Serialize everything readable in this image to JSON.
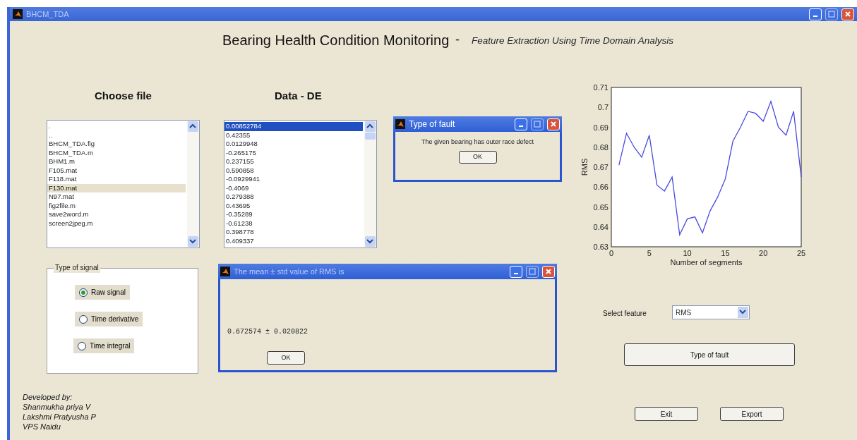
{
  "window": {
    "title": "BHCM_TDA"
  },
  "heading": {
    "title": "Bearing Health Condition Monitoring",
    "separator": "-",
    "subtitle": "Feature Extraction Using Time Domain Analysis"
  },
  "file_list": {
    "label": "Choose file",
    "focused": false,
    "items": [
      {
        "text": ".",
        "selected": false
      },
      {
        "text": "..",
        "selected": false
      },
      {
        "text": "BHCM_TDA.fig",
        "selected": false
      },
      {
        "text": "BHCM_TDA.m",
        "selected": false
      },
      {
        "text": "BHM1.m",
        "selected": false
      },
      {
        "text": "F105.mat",
        "selected": false
      },
      {
        "text": "F118.mat",
        "selected": false
      },
      {
        "text": "F130.mat",
        "selected": true
      },
      {
        "text": "N97.mat",
        "selected": false
      },
      {
        "text": "fig2file.m",
        "selected": false
      },
      {
        "text": "save2word.m",
        "selected": false
      },
      {
        "text": "screen2jpeg.m",
        "selected": false
      }
    ]
  },
  "data_list": {
    "label": "Data - DE",
    "focused": true,
    "items": [
      {
        "text": "0.00852784",
        "selected": true
      },
      {
        "text": "0.42355",
        "selected": false
      },
      {
        "text": "0.0129948",
        "selected": false
      },
      {
        "text": "-0.265175",
        "selected": false
      },
      {
        "text": "0.237155",
        "selected": false
      },
      {
        "text": "0.590858",
        "selected": false
      },
      {
        "text": "-0.0929941",
        "selected": false
      },
      {
        "text": "-0.4069",
        "selected": false
      },
      {
        "text": "0.279388",
        "selected": false
      },
      {
        "text": "0.43695",
        "selected": false
      },
      {
        "text": "-0.35289",
        "selected": false
      },
      {
        "text": "-0.61238",
        "selected": false
      },
      {
        "text": "0.398778",
        "selected": false
      },
      {
        "text": "0.409337",
        "selected": false
      }
    ]
  },
  "signal_panel": {
    "title": "Type of signal",
    "options": [
      {
        "label": "Raw signal",
        "selected": true
      },
      {
        "label": "Time derivative",
        "selected": false
      },
      {
        "label": "Time integral",
        "selected": false
      }
    ]
  },
  "credits": [
    "Developed by:",
    "Shanmukha priya V",
    "Lakshmi Pratyusha P",
    "VPS Naidu"
  ],
  "chart": {
    "chart_data": {
      "type": "line",
      "xlabel": "Number of segments",
      "ylabel": "RMS",
      "x": [
        1,
        2,
        3,
        4,
        5,
        6,
        7,
        8,
        9,
        10,
        11,
        12,
        13,
        14,
        15,
        16,
        17,
        18,
        19,
        20,
        21,
        22,
        23,
        24,
        25
      ],
      "series": [
        {
          "color": "#4a4ae0",
          "values": [
            0.671,
            0.687,
            0.68,
            0.675,
            0.686,
            0.661,
            0.658,
            0.665,
            0.636,
            0.644,
            0.645,
            0.637,
            0.648,
            0.655,
            0.664,
            0.683,
            0.69,
            0.698,
            0.697,
            0.693,
            0.703,
            0.69,
            0.686,
            0.698,
            0.665
          ]
        }
      ],
      "xlim": [
        0,
        25
      ],
      "ylim": [
        0.63,
        0.71
      ],
      "xticks": [
        0,
        5,
        10,
        15,
        20,
        25
      ],
      "yticks": [
        0.63,
        0.64,
        0.65,
        0.66,
        0.67,
        0.68,
        0.69,
        0.7,
        0.71
      ]
    }
  },
  "feature": {
    "label": "Select feature",
    "value": "RMS"
  },
  "fault_button": {
    "label": "Type of fault"
  },
  "exit_button": {
    "label": "Exit"
  },
  "export_button": {
    "label": "Export"
  },
  "dialogs": [
    {
      "kind": "message",
      "title": "Type of fault",
      "message": "The given bearing has outer race defect",
      "button": "OK"
    },
    {
      "kind": "result",
      "title": "The mean ± std value of RMS is",
      "message": "0.672574 ± 0.020822",
      "button": "OK"
    }
  ]
}
